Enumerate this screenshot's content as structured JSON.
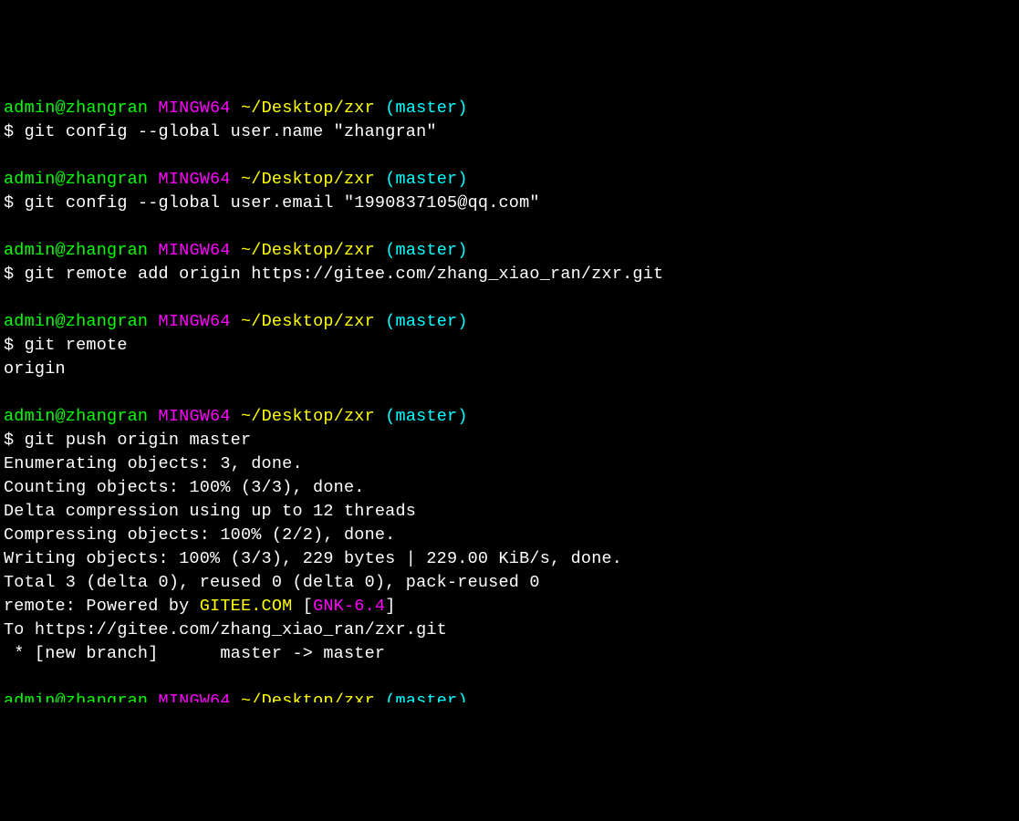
{
  "prompt": {
    "user_host": "admin@zhangran",
    "mingw": "MINGW64",
    "path": "~/Desktop/zxr",
    "branch": "(master)",
    "dollar": "$"
  },
  "blocks": [
    {
      "cmd": "git config --global user.name \"zhangran\"",
      "output": []
    },
    {
      "cmd": "git config --global user.email \"1990837105@qq.com\"",
      "output": []
    },
    {
      "cmd": "git remote add origin https://gitee.com/zhang_xiao_ran/zxr.git",
      "output": []
    },
    {
      "cmd": "git remote",
      "output": [
        "origin"
      ]
    },
    {
      "cmd": "git push origin master",
      "output": [
        "Enumerating objects: 3, done.",
        "Counting objects: 100% (3/3), done.",
        "Delta compression using up to 12 threads",
        "Compressing objects: 100% (2/2), done.",
        "Writing objects: 100% (3/3), 229 bytes | 229.00 KiB/s, done.",
        "Total 3 (delta 0), reused 0 (delta 0), pack-reused 0"
      ],
      "richOutput": {
        "remote_prefix": "remote: Powered by ",
        "remote_gitee": "GITEE.COM",
        "remote_bracket_open": " [",
        "remote_gnk": "GNK-6.4",
        "remote_bracket_close": "]"
      },
      "output2": [
        "To https://gitee.com/zhang_xiao_ran/zxr.git",
        " * [new branch]      master -> master"
      ]
    }
  ]
}
